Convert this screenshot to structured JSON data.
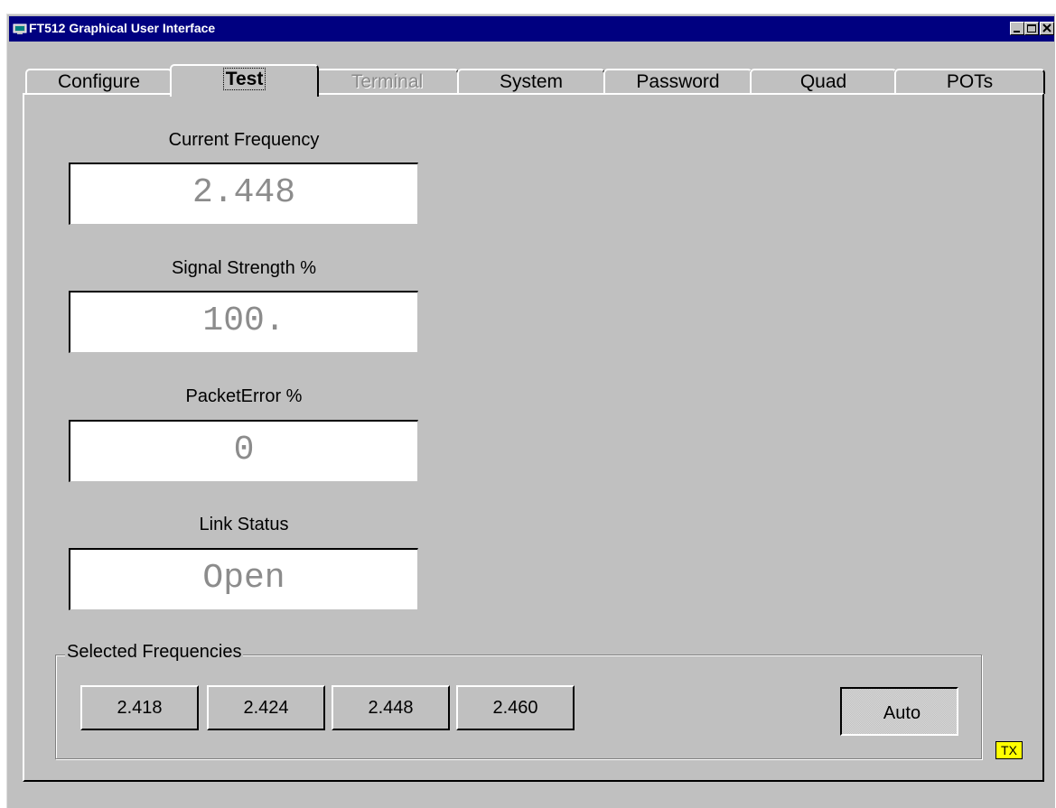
{
  "window": {
    "title": "FT512 Graphical User Interface",
    "titlebar_color": "#000080",
    "controls": [
      "minimize-icon",
      "maximize-icon",
      "close-icon"
    ]
  },
  "tabs": [
    {
      "label": "Configure",
      "state": "normal"
    },
    {
      "label": "Test",
      "state": "selected"
    },
    {
      "label": "Terminal",
      "state": "disabled"
    },
    {
      "label": "System",
      "state": "normal"
    },
    {
      "label": "Password",
      "state": "normal"
    },
    {
      "label": "Quad",
      "state": "normal"
    },
    {
      "label": "POTs",
      "state": "normal"
    }
  ],
  "readouts": {
    "current_frequency": {
      "label": "Current Frequency",
      "value": "2.448"
    },
    "signal_strength": {
      "label": "Signal Strength %",
      "value": "100."
    },
    "packet_error": {
      "label": "PacketError %",
      "value": "0"
    },
    "link_status": {
      "label": "Link Status",
      "value": "Open"
    }
  },
  "selected_frequencies": {
    "title": "Selected Frequencies",
    "buttons": [
      "2.418",
      "2.424",
      "2.448",
      "2.460"
    ],
    "auto_label": "Auto",
    "auto_pressed": true
  },
  "tx_indicator": {
    "label": "TX",
    "color": "#ffff00"
  }
}
